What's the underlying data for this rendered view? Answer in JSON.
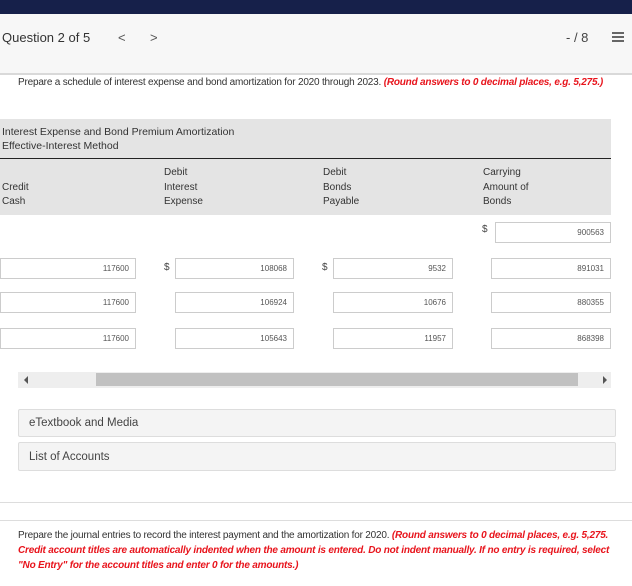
{
  "header": {
    "question_label": "Question 2 of 5",
    "prev": "<",
    "next": ">",
    "score": "- / 8"
  },
  "instruction1": {
    "text": "Prepare a schedule of interest expense and bond amortization for 2020 through 2023. ",
    "note": "(Round answers to 0 decimal places, e.g. 5,275.)"
  },
  "table": {
    "title1": "Interest Expense and Bond Premium Amortization",
    "title2": "Effective-Interest Method",
    "columns": [
      "Credit\nCash",
      "Debit\nInterest\nExpense",
      "Debit\nBonds\nPayable",
      "Carrying\nAmount of\nBonds"
    ],
    "col0": [
      "",
      "Credit",
      "Cash"
    ],
    "col1": [
      "Debit",
      "Interest",
      "Expense"
    ],
    "col2": [
      "Debit",
      "Bonds",
      "Payable"
    ],
    "col3": [
      "Carrying",
      "Amount of",
      "Bonds"
    ],
    "currency": "$",
    "initial_carrying": "900563",
    "rows": [
      {
        "cash": "117600",
        "interest": "108068",
        "bonds": "9532",
        "carrying": "891031"
      },
      {
        "cash": "117600",
        "interest": "106924",
        "bonds": "10676",
        "carrying": "880355"
      },
      {
        "cash": "117600",
        "interest": "105643",
        "bonds": "11957",
        "carrying": "868398"
      }
    ]
  },
  "panels": {
    "etextbook": "eTextbook and Media",
    "accounts": "List of Accounts"
  },
  "instruction2": {
    "text": "Prepare the journal entries to record the interest payment and the amortization for 2020. ",
    "note": "(Round answers to 0 decimal places, e.g. 5,275. Credit account titles are automatically indented when the amount is entered. Do not indent manually. If no entry is required, select \"No Entry\" for the account titles and enter 0 for the amounts.)"
  }
}
